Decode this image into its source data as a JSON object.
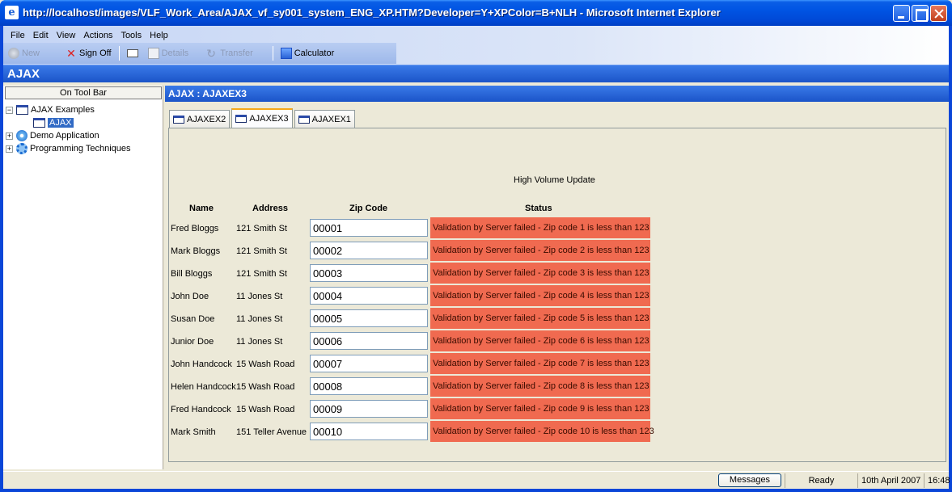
{
  "window": {
    "title": "http://localhost/images/VLF_Work_Area/AJAX_vf_sy001_system_ENG_XP.HTM?Developer=Y+XPColor=B+NLH - Microsoft Internet Explorer"
  },
  "menu": [
    "File",
    "Edit",
    "View",
    "Actions",
    "Tools",
    "Help"
  ],
  "toolbar": {
    "new": "New",
    "sign_off": "Sign Off",
    "details": "Details",
    "transfer": "Transfer",
    "calculator": "Calculator"
  },
  "app_title": "AJAX",
  "left": {
    "on_tool_bar": "On Tool Bar",
    "tree": {
      "ajax_examples": "AJAX Examples",
      "ajax": "AJAX",
      "demo_application": "Demo Application",
      "programming_techniques": "Programming Techniques"
    }
  },
  "pane_title": "AJAX : AJAXEX3",
  "tabs": [
    "AJAXEX2",
    "AJAXEX3",
    "AJAXEX1"
  ],
  "content": {
    "heading": "High Volume Update",
    "headers": {
      "name": "Name",
      "address": "Address",
      "zip": "Zip Code",
      "status": "Status"
    },
    "rows": [
      {
        "name": "Fred Bloggs",
        "address": "121 Smith St",
        "zip": "00001",
        "status": "Validation by Server failed - Zip code 1 is less than 123"
      },
      {
        "name": "Mark Bloggs",
        "address": "121 Smith St",
        "zip": "00002",
        "status": "Validation by Server failed - Zip code 2 is less than 123"
      },
      {
        "name": "Bill Bloggs",
        "address": "121 Smith St",
        "zip": "00003",
        "status": "Validation by Server failed - Zip code 3 is less than 123"
      },
      {
        "name": "John Doe",
        "address": "11 Jones St",
        "zip": "00004",
        "status": "Validation by Server failed - Zip code 4 is less than 123"
      },
      {
        "name": "Susan Doe",
        "address": "11 Jones St",
        "zip": "00005",
        "status": "Validation by Server failed - Zip code 5 is less than 123"
      },
      {
        "name": "Junior Doe",
        "address": "11 Jones St",
        "zip": "00006",
        "status": "Validation by Server failed - Zip code 6 is less than 123"
      },
      {
        "name": "John Handcock",
        "address": "15 Wash Road",
        "zip": "00007",
        "status": "Validation by Server failed - Zip code 7 is less than 123"
      },
      {
        "name": "Helen Handcock",
        "address": "15 Wash Road",
        "zip": "00008",
        "status": "Validation by Server failed - Zip code 8 is less than 123"
      },
      {
        "name": "Fred Handcock",
        "address": "15 Wash Road",
        "zip": "00009",
        "status": "Validation by Server failed - Zip code 9 is less than 123"
      },
      {
        "name": "Mark Smith",
        "address": "151 Teller Avenue",
        "zip": "00010",
        "status": "Validation by Server failed - Zip code 10 is less than 123"
      }
    ]
  },
  "statusbar": {
    "messages": "Messages",
    "ready": "Ready",
    "date": "10th April 2007",
    "time": "16:48"
  },
  "colors": {
    "status_error": "#f06a50",
    "title_blue": "#0054e3",
    "header_blue": "#1b54c8"
  }
}
